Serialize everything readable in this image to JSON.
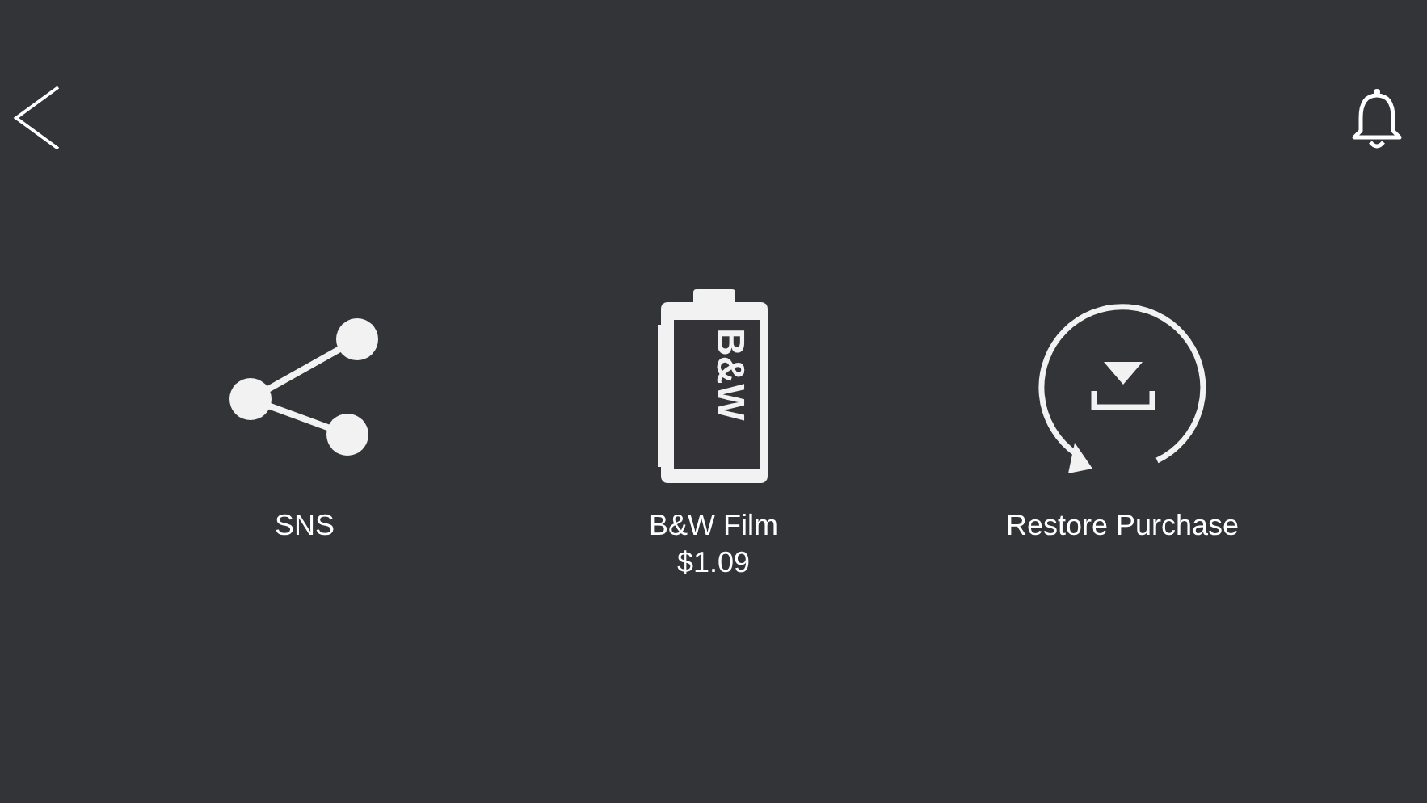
{
  "items": [
    {
      "kind": "share",
      "label": "SNS"
    },
    {
      "kind": "film",
      "label": "B&W Film",
      "price": "$1.09",
      "film_label": "B&W"
    },
    {
      "kind": "restore",
      "label": "Restore Purchase"
    }
  ]
}
